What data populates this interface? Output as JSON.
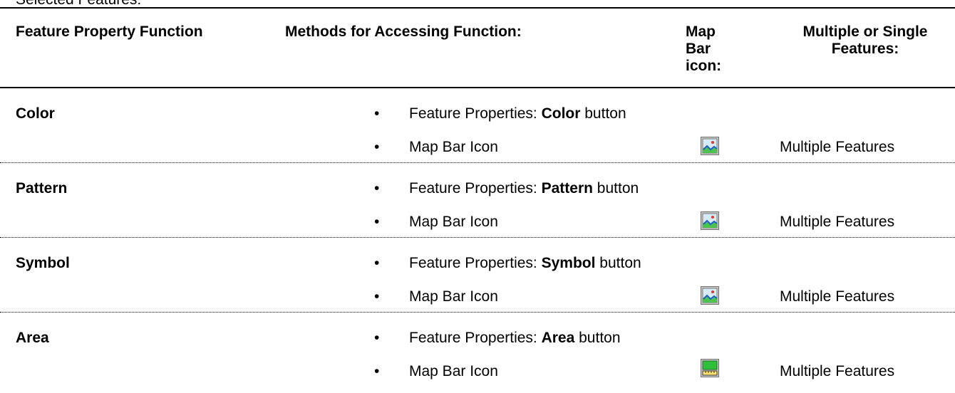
{
  "caption": "Selected Features:",
  "headers": {
    "function": "Feature Property Function",
    "methods": "Methods for Accessing Function:",
    "map_bar_icon": [
      "Map",
      "Bar",
      "icon:"
    ],
    "multiple_single": [
      "Multiple or Single",
      "Features:"
    ]
  },
  "rows": [
    {
      "function": "Color",
      "method_prefix": "Feature Properties: ",
      "method_button": "Color",
      "method_suffix": " button",
      "method2": "Map Bar Icon",
      "icon": "map-display-icon",
      "applies_to": "Multiple Features"
    },
    {
      "function": "Pattern",
      "method_prefix": "Feature Properties: ",
      "method_button": "Pattern",
      "method_suffix": " button",
      "method2": "Map Bar Icon",
      "icon": "map-display-icon",
      "applies_to": "Multiple Features"
    },
    {
      "function": "Symbol",
      "method_prefix": "Feature Properties: ",
      "method_button": "Symbol",
      "method_suffix": " button",
      "method2": "Map Bar Icon",
      "icon": "map-display-icon",
      "applies_to": "Multiple Features"
    },
    {
      "function": "Area",
      "method_prefix": "Feature Properties: ",
      "method_button": "Area",
      "method_suffix": " button",
      "method2": "Map Bar Icon",
      "icon": "area-measure-icon",
      "applies_to": "Multiple Features"
    }
  ],
  "bullet": "•"
}
